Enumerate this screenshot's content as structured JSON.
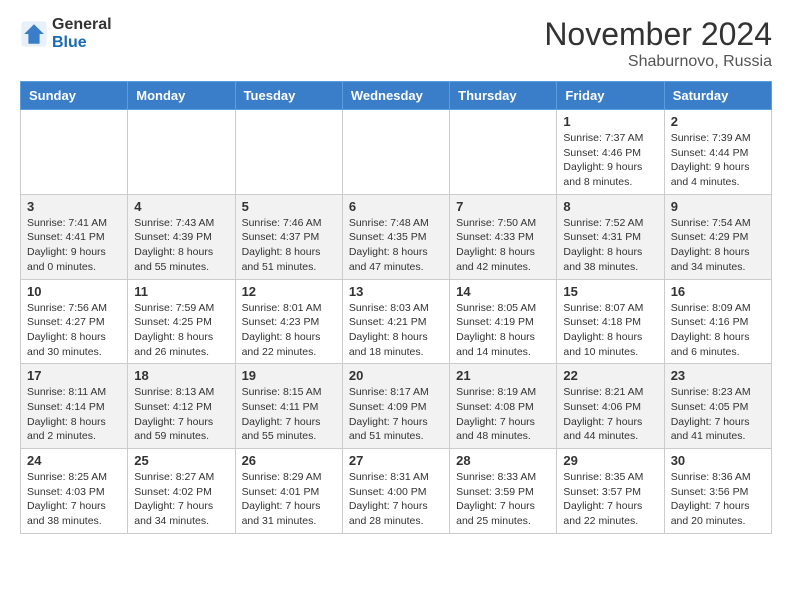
{
  "header": {
    "logo_general": "General",
    "logo_blue": "Blue",
    "month_title": "November 2024",
    "location": "Shaburnovo, Russia"
  },
  "days_of_week": [
    "Sunday",
    "Monday",
    "Tuesday",
    "Wednesday",
    "Thursday",
    "Friday",
    "Saturday"
  ],
  "weeks": [
    [
      {
        "num": "",
        "sunrise": "",
        "sunset": "",
        "daylight": ""
      },
      {
        "num": "",
        "sunrise": "",
        "sunset": "",
        "daylight": ""
      },
      {
        "num": "",
        "sunrise": "",
        "sunset": "",
        "daylight": ""
      },
      {
        "num": "",
        "sunrise": "",
        "sunset": "",
        "daylight": ""
      },
      {
        "num": "",
        "sunrise": "",
        "sunset": "",
        "daylight": ""
      },
      {
        "num": "1",
        "sunrise": "Sunrise: 7:37 AM",
        "sunset": "Sunset: 4:46 PM",
        "daylight": "Daylight: 9 hours and 8 minutes."
      },
      {
        "num": "2",
        "sunrise": "Sunrise: 7:39 AM",
        "sunset": "Sunset: 4:44 PM",
        "daylight": "Daylight: 9 hours and 4 minutes."
      }
    ],
    [
      {
        "num": "3",
        "sunrise": "Sunrise: 7:41 AM",
        "sunset": "Sunset: 4:41 PM",
        "daylight": "Daylight: 9 hours and 0 minutes."
      },
      {
        "num": "4",
        "sunrise": "Sunrise: 7:43 AM",
        "sunset": "Sunset: 4:39 PM",
        "daylight": "Daylight: 8 hours and 55 minutes."
      },
      {
        "num": "5",
        "sunrise": "Sunrise: 7:46 AM",
        "sunset": "Sunset: 4:37 PM",
        "daylight": "Daylight: 8 hours and 51 minutes."
      },
      {
        "num": "6",
        "sunrise": "Sunrise: 7:48 AM",
        "sunset": "Sunset: 4:35 PM",
        "daylight": "Daylight: 8 hours and 47 minutes."
      },
      {
        "num": "7",
        "sunrise": "Sunrise: 7:50 AM",
        "sunset": "Sunset: 4:33 PM",
        "daylight": "Daylight: 8 hours and 42 minutes."
      },
      {
        "num": "8",
        "sunrise": "Sunrise: 7:52 AM",
        "sunset": "Sunset: 4:31 PM",
        "daylight": "Daylight: 8 hours and 38 minutes."
      },
      {
        "num": "9",
        "sunrise": "Sunrise: 7:54 AM",
        "sunset": "Sunset: 4:29 PM",
        "daylight": "Daylight: 8 hours and 34 minutes."
      }
    ],
    [
      {
        "num": "10",
        "sunrise": "Sunrise: 7:56 AM",
        "sunset": "Sunset: 4:27 PM",
        "daylight": "Daylight: 8 hours and 30 minutes."
      },
      {
        "num": "11",
        "sunrise": "Sunrise: 7:59 AM",
        "sunset": "Sunset: 4:25 PM",
        "daylight": "Daylight: 8 hours and 26 minutes."
      },
      {
        "num": "12",
        "sunrise": "Sunrise: 8:01 AM",
        "sunset": "Sunset: 4:23 PM",
        "daylight": "Daylight: 8 hours and 22 minutes."
      },
      {
        "num": "13",
        "sunrise": "Sunrise: 8:03 AM",
        "sunset": "Sunset: 4:21 PM",
        "daylight": "Daylight: 8 hours and 18 minutes."
      },
      {
        "num": "14",
        "sunrise": "Sunrise: 8:05 AM",
        "sunset": "Sunset: 4:19 PM",
        "daylight": "Daylight: 8 hours and 14 minutes."
      },
      {
        "num": "15",
        "sunrise": "Sunrise: 8:07 AM",
        "sunset": "Sunset: 4:18 PM",
        "daylight": "Daylight: 8 hours and 10 minutes."
      },
      {
        "num": "16",
        "sunrise": "Sunrise: 8:09 AM",
        "sunset": "Sunset: 4:16 PM",
        "daylight": "Daylight: 8 hours and 6 minutes."
      }
    ],
    [
      {
        "num": "17",
        "sunrise": "Sunrise: 8:11 AM",
        "sunset": "Sunset: 4:14 PM",
        "daylight": "Daylight: 8 hours and 2 minutes."
      },
      {
        "num": "18",
        "sunrise": "Sunrise: 8:13 AM",
        "sunset": "Sunset: 4:12 PM",
        "daylight": "Daylight: 7 hours and 59 minutes."
      },
      {
        "num": "19",
        "sunrise": "Sunrise: 8:15 AM",
        "sunset": "Sunset: 4:11 PM",
        "daylight": "Daylight: 7 hours and 55 minutes."
      },
      {
        "num": "20",
        "sunrise": "Sunrise: 8:17 AM",
        "sunset": "Sunset: 4:09 PM",
        "daylight": "Daylight: 7 hours and 51 minutes."
      },
      {
        "num": "21",
        "sunrise": "Sunrise: 8:19 AM",
        "sunset": "Sunset: 4:08 PM",
        "daylight": "Daylight: 7 hours and 48 minutes."
      },
      {
        "num": "22",
        "sunrise": "Sunrise: 8:21 AM",
        "sunset": "Sunset: 4:06 PM",
        "daylight": "Daylight: 7 hours and 44 minutes."
      },
      {
        "num": "23",
        "sunrise": "Sunrise: 8:23 AM",
        "sunset": "Sunset: 4:05 PM",
        "daylight": "Daylight: 7 hours and 41 minutes."
      }
    ],
    [
      {
        "num": "24",
        "sunrise": "Sunrise: 8:25 AM",
        "sunset": "Sunset: 4:03 PM",
        "daylight": "Daylight: 7 hours and 38 minutes."
      },
      {
        "num": "25",
        "sunrise": "Sunrise: 8:27 AM",
        "sunset": "Sunset: 4:02 PM",
        "daylight": "Daylight: 7 hours and 34 minutes."
      },
      {
        "num": "26",
        "sunrise": "Sunrise: 8:29 AM",
        "sunset": "Sunset: 4:01 PM",
        "daylight": "Daylight: 7 hours and 31 minutes."
      },
      {
        "num": "27",
        "sunrise": "Sunrise: 8:31 AM",
        "sunset": "Sunset: 4:00 PM",
        "daylight": "Daylight: 7 hours and 28 minutes."
      },
      {
        "num": "28",
        "sunrise": "Sunrise: 8:33 AM",
        "sunset": "Sunset: 3:59 PM",
        "daylight": "Daylight: 7 hours and 25 minutes."
      },
      {
        "num": "29",
        "sunrise": "Sunrise: 8:35 AM",
        "sunset": "Sunset: 3:57 PM",
        "daylight": "Daylight: 7 hours and 22 minutes."
      },
      {
        "num": "30",
        "sunrise": "Sunrise: 8:36 AM",
        "sunset": "Sunset: 3:56 PM",
        "daylight": "Daylight: 7 hours and 20 minutes."
      }
    ]
  ]
}
